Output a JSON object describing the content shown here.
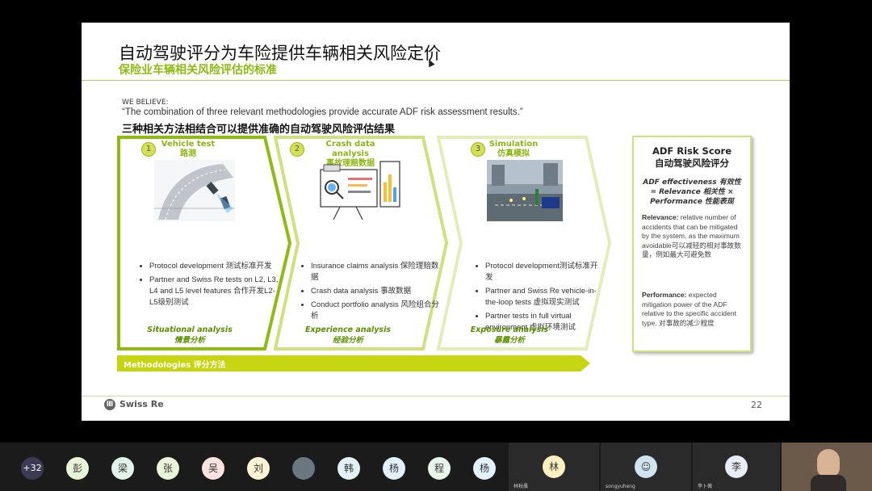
{
  "slide": {
    "title": "自动驾驶评分为车险提供车辆相关风险定价",
    "subtitle": "保险业车辆相关风险评估的标准",
    "we_believe_label": "WE BELIEVE:",
    "quote": "“The combination of three relevant methodologies provide accurate ADF risk assessment results.”",
    "quote_cn": "三种相关方法相结合可以提供准确的自动驾驶风险评估结果",
    "panels": [
      {
        "num": "1",
        "title_en": "Vehicle test",
        "title_cn": "路测",
        "illustration": "road-test-illustration",
        "bullets": [
          "Protocol development 测试标准开发",
          "Partner and Swiss Re tests on L2, L3, L4 and L5 level features 合作开发L2-L5级别测试"
        ],
        "analysis_en": "Situational analysis",
        "analysis_cn": "情景分析"
      },
      {
        "num": "2",
        "title_en": "Crash data analysis",
        "title_cn": "事故理赔数据",
        "illustration": "data-analysis-illustration",
        "bullets": [
          "Insurance claims analysis 保险理赔数据",
          "Crash data analysis 事故数据",
          "Conduct portfolio analysis 风险组合分析"
        ],
        "analysis_en": "Experience analysis",
        "analysis_cn": "经验分析"
      },
      {
        "num": "3",
        "title_en": "Simulation",
        "title_cn": "仿真模拟",
        "illustration": "simulation-illustration",
        "bullets": [
          "Protocol development测试标准开发",
          "Partner and Swiss Re vehicle-in-the-loop tests 虚拟现实测试",
          "Partner tests in full virtual environment 虚拟环境测试"
        ],
        "analysis_en": "Exposure analysis",
        "analysis_cn": "暴露分析"
      }
    ],
    "risk": {
      "title_en": "ADF Risk Score",
      "title_cn": "自动驾驶风险评分",
      "formula_1": "ADF effectiveness 有效性",
      "formula_2": "= Relevance 相关性 ×",
      "formula_3": "Performance 性能表现",
      "relevance_label": "Relevance:",
      "relevance_text": " relative number of accidents that can be mitigated by the system, as the maximum avoidable可以减轻的相对事故数量，例如最大可避免数",
      "performance_label": "Performance:",
      "performance_text": " expected mitigation power of the ADF relative to the specific accident type. 对事故的减少程度"
    },
    "methodologies": "Methodologies 评分方法",
    "logo": "Swiss Re",
    "page_number": "22"
  },
  "participants": {
    "more": "+32",
    "avatars": [
      "彭",
      "梁",
      "张",
      "吴",
      "刘",
      "",
      "韩",
      "杨",
      "程",
      "杨"
    ],
    "tile_avatars": [
      "林",
      "李"
    ],
    "tile_names": [
      "林秋晨",
      "songyuheng",
      "李卜薇"
    ]
  },
  "colors": {
    "accent": "#c3d62f",
    "dark_green": "#7fb000",
    "bar": "#c6d411"
  }
}
